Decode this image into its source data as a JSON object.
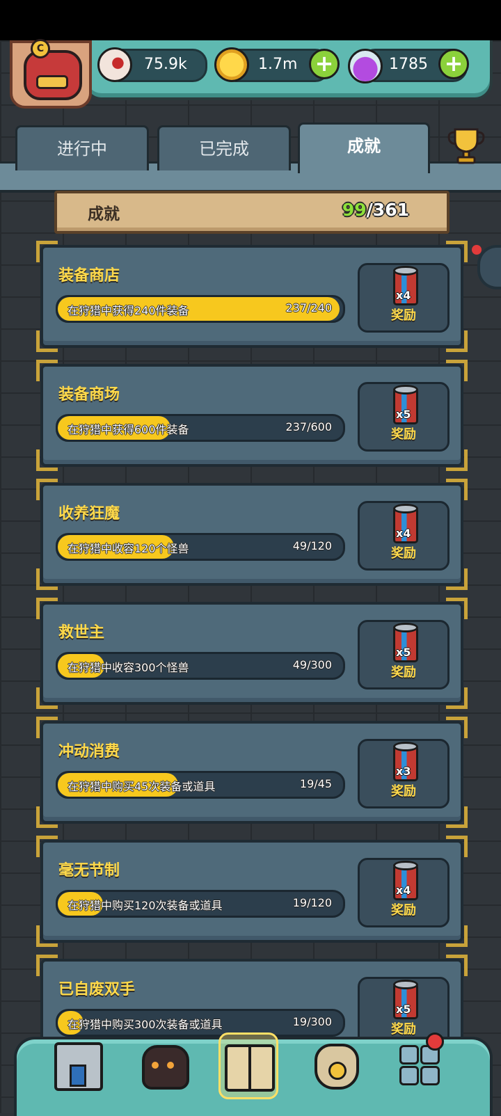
{
  "resources": [
    {
      "name": "eyeball",
      "icon": "eyeball-icon",
      "value": "75.9k",
      "has_plus": false
    },
    {
      "name": "coin",
      "icon": "coin-icon",
      "value": "1.7m",
      "has_plus": true
    },
    {
      "name": "potion",
      "icon": "potion-icon",
      "value": "1785",
      "has_plus": true
    }
  ],
  "avatar": {
    "badge": "C"
  },
  "tabs": [
    {
      "label": "进行中",
      "active": false
    },
    {
      "label": "已完成",
      "active": false
    },
    {
      "label": "成就",
      "active": true
    }
  ],
  "summary": {
    "label": "成就",
    "done": "99",
    "total": "/361"
  },
  "achievements": [
    {
      "title": "装备商店",
      "desc": "在狩猎中获得240件装备",
      "progress": "237/240",
      "fraction": 0.9875,
      "reward_qty": "x4",
      "reward_label": "奖励"
    },
    {
      "title": "装备商场",
      "desc": "在狩猎中获得600件装备",
      "progress": "237/600",
      "fraction": 0.395,
      "reward_qty": "x5",
      "reward_label": "奖励"
    },
    {
      "title": "收养狂魔",
      "desc": "在狩猎中收容120个怪兽",
      "progress": "49/120",
      "fraction": 0.408,
      "reward_qty": "x4",
      "reward_label": "奖励"
    },
    {
      "title": "救世主",
      "desc": "在狩猎中收容300个怪兽",
      "progress": "49/300",
      "fraction": 0.163,
      "reward_qty": "x5",
      "reward_label": "奖励"
    },
    {
      "title": "冲动消费",
      "desc": "在狩猎中购买45次装备或道具",
      "progress": "19/45",
      "fraction": 0.422,
      "reward_qty": "x3",
      "reward_label": "奖励"
    },
    {
      "title": "毫无节制",
      "desc": "在狩猎中购买120次装备或道具",
      "progress": "19/120",
      "fraction": 0.158,
      "reward_qty": "x4",
      "reward_label": "奖励"
    },
    {
      "title": "已自废双手",
      "desc": "在狩猎中购买300次装备或道具",
      "progress": "19/300",
      "fraction": 0.063,
      "reward_qty": "x5",
      "reward_label": "奖励"
    }
  ],
  "bottom_nav": [
    {
      "name": "shop",
      "icon": "shop-icon",
      "active": false
    },
    {
      "name": "monster",
      "icon": "monster-icon",
      "active": false
    },
    {
      "name": "book",
      "icon": "book-icon",
      "active": true
    },
    {
      "name": "bag",
      "icon": "money-bag-icon",
      "active": false
    },
    {
      "name": "grid",
      "icon": "grid-menu-icon",
      "active": false
    }
  ],
  "colors": {
    "accent": "#ffd94a",
    "progress": "#f7c81e",
    "done_count": "#8ee03a",
    "header": "#5fb9b1"
  }
}
